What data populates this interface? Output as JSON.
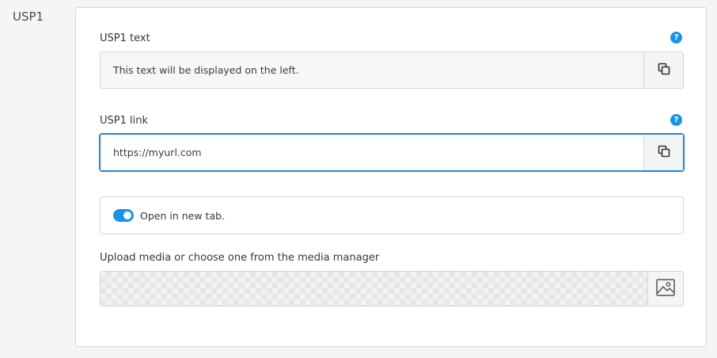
{
  "section": {
    "title": "USP1"
  },
  "usp_text": {
    "label": "USP1 text",
    "help": "?",
    "value": "This text will be displayed on the left.",
    "copy_icon": "copy-icon"
  },
  "usp_link": {
    "label": "USP1 link",
    "help": "?",
    "value": "https://myurl.com",
    "copy_icon": "copy-icon"
  },
  "new_tab": {
    "label": "Open in new tab.",
    "enabled": true
  },
  "media": {
    "label": "Upload media or choose one from the media manager",
    "button_icon": "image-icon"
  },
  "colors": {
    "accent": "#1893e7",
    "focus_border": "#1e88c7"
  }
}
